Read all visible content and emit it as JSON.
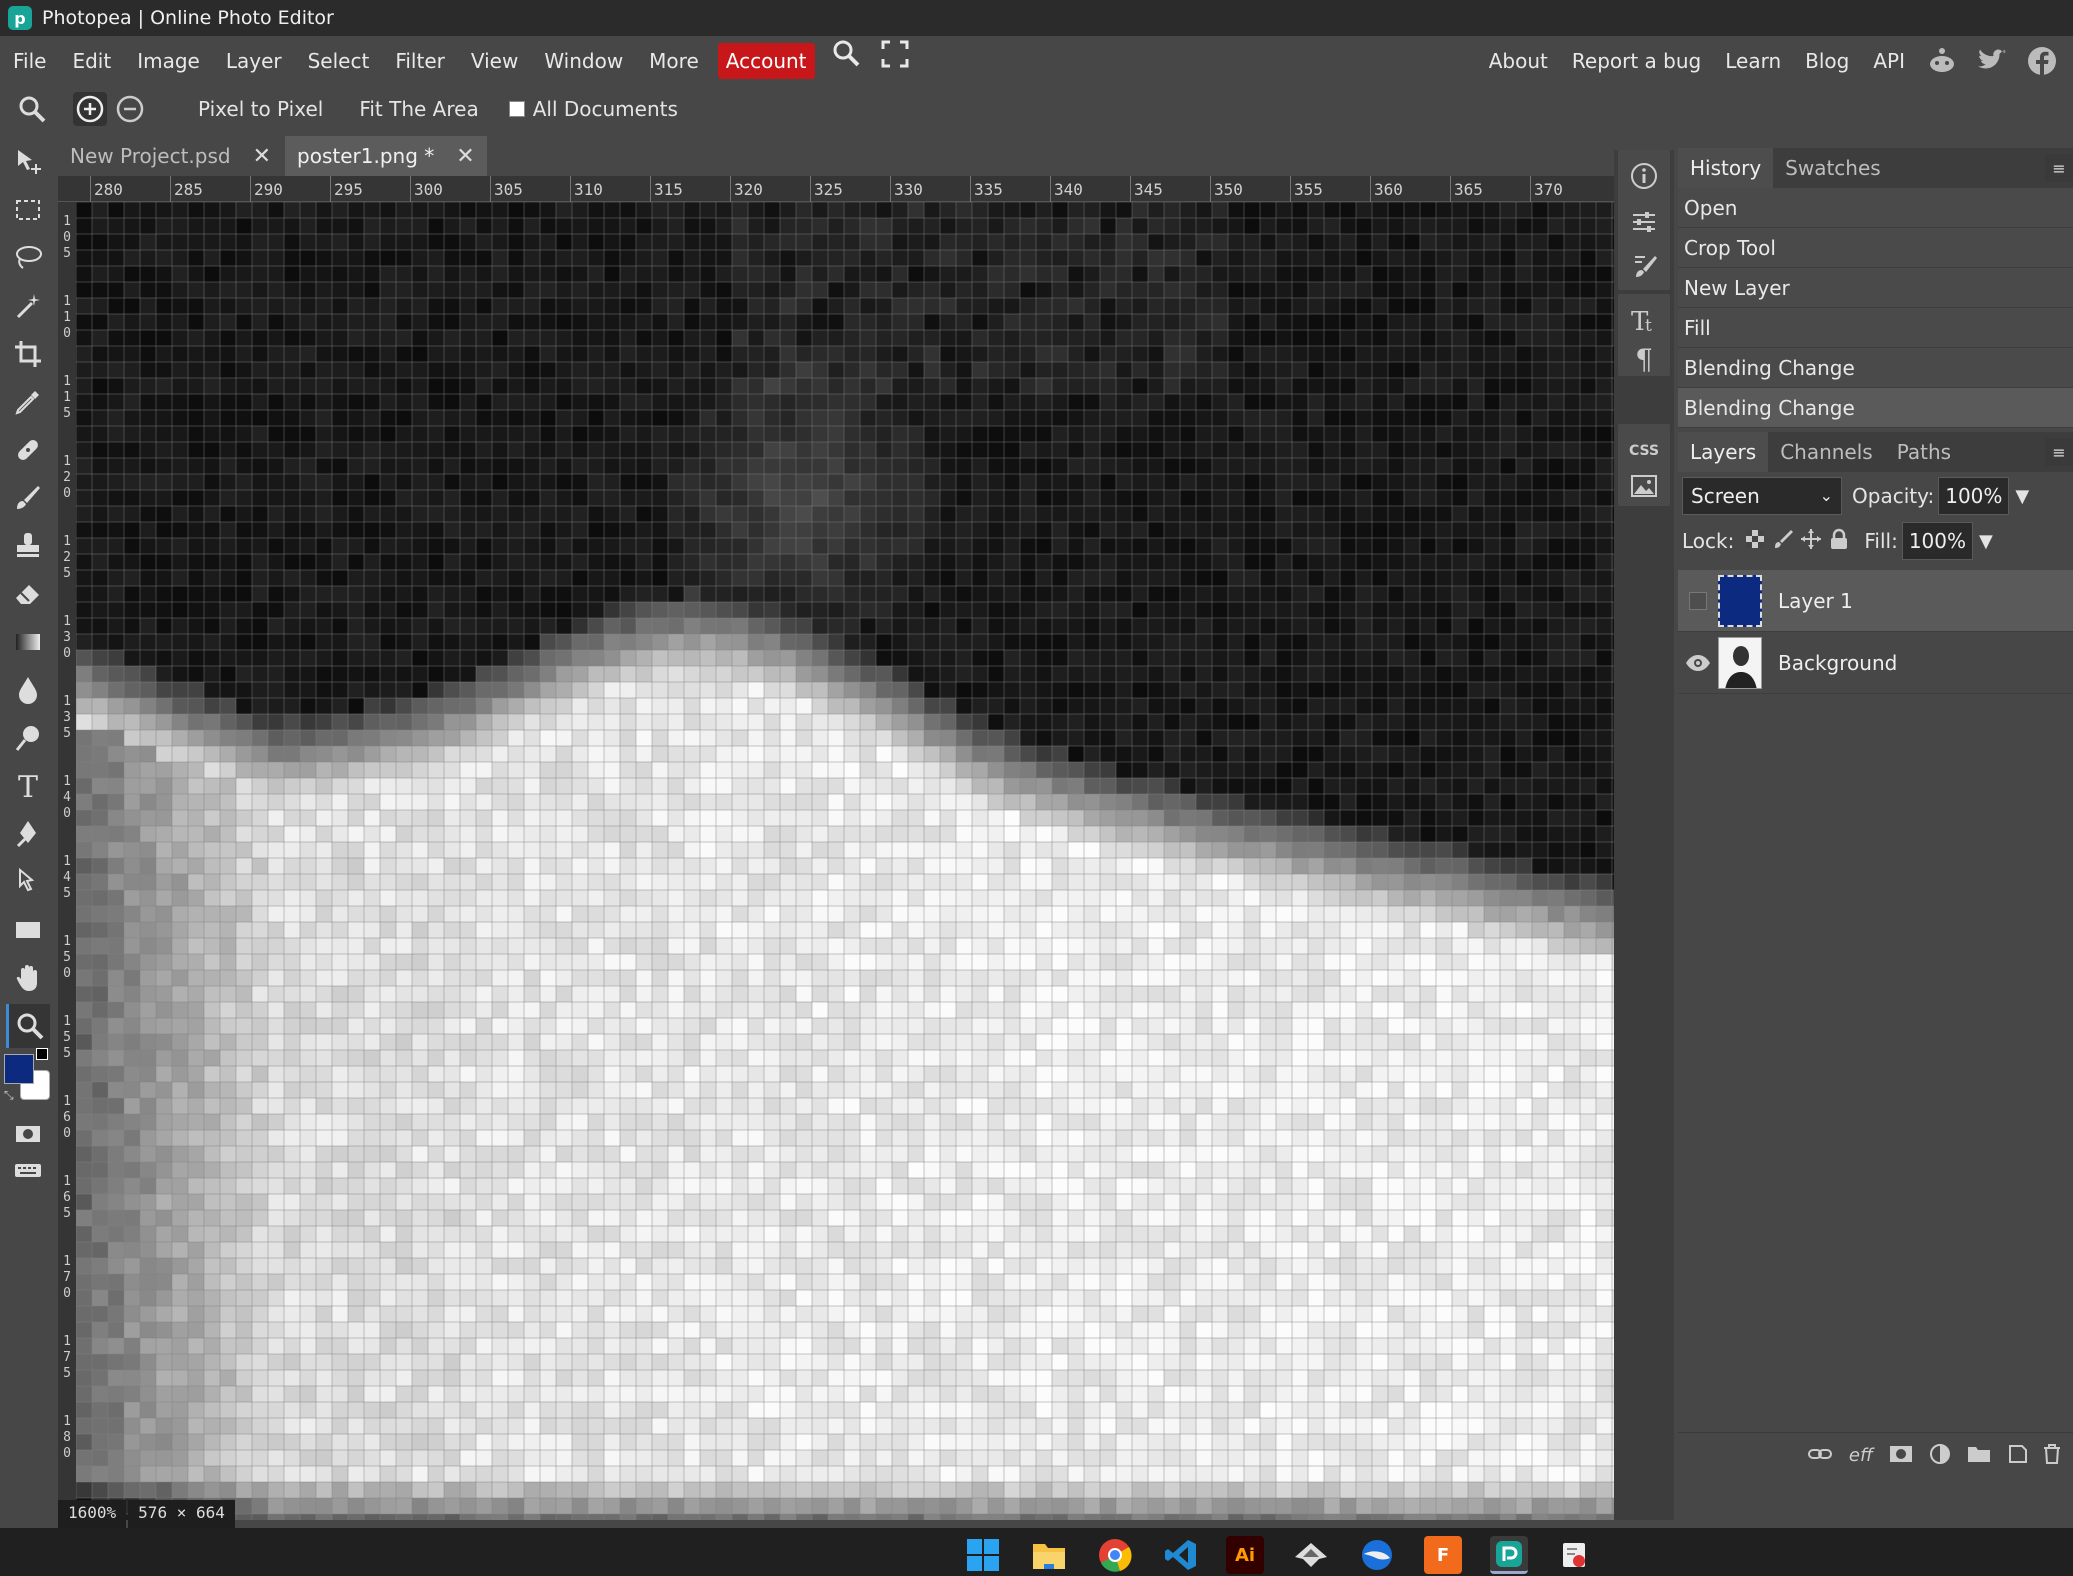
{
  "window": {
    "title": "Photopea | Online Photo Editor"
  },
  "menu": {
    "items": [
      "File",
      "Edit",
      "Image",
      "Layer",
      "Select",
      "Filter",
      "View",
      "Window",
      "More"
    ],
    "account": "Account",
    "right": [
      "About",
      "Report a bug",
      "Learn",
      "Blog",
      "API"
    ]
  },
  "options": {
    "pixel_to_pixel": "Pixel to Pixel",
    "fit_the_area": "Fit The Area",
    "all_documents": "All Documents"
  },
  "doc_tabs": [
    {
      "label": "New Project.psd",
      "close": "✕"
    },
    {
      "label": "poster1.png *",
      "close": "✕"
    }
  ],
  "ruler": {
    "h_ticks": [
      "280",
      "285",
      "290",
      "295",
      "300",
      "305",
      "310",
      "315",
      "320",
      "325",
      "330",
      "335",
      "340",
      "345",
      "350",
      "355",
      "360",
      "365",
      "370"
    ],
    "v_ticks": [
      "105",
      "110",
      "115",
      "120",
      "125",
      "130",
      "135",
      "140",
      "145",
      "150",
      "155",
      "160",
      "165",
      "170",
      "175",
      "180"
    ]
  },
  "status": {
    "zoom": "1600%",
    "size": "576 × 664"
  },
  "history_panel": {
    "tabs": [
      "History",
      "Swatches"
    ],
    "items": [
      "Open",
      "Crop Tool",
      "New Layer",
      "Fill",
      "Blending Change",
      "Blending Change"
    ]
  },
  "layers_panel": {
    "tabs": [
      "Layers",
      "Channels",
      "Paths"
    ],
    "blend_mode": "Screen",
    "opacity_label": "Opacity:",
    "opacity": "100%",
    "lock_label": "Lock:",
    "fill_label": "Fill:",
    "fill": "100%",
    "layers": [
      {
        "name": "Layer 1",
        "visible": false,
        "selected": true
      },
      {
        "name": "Background",
        "visible": true,
        "selected": false
      }
    ],
    "footer_icons": [
      "link-icon",
      "effects-icon",
      "mask-icon",
      "adjustment-icon",
      "folder-icon",
      "new-layer-icon",
      "trash-icon"
    ]
  },
  "colors": {
    "foreground": "#0b2a80",
    "background": "#ffffff",
    "account": "#c8171b",
    "accent": "#3d8bd6",
    "app_icon": "#18a497"
  },
  "side_panel_icons": [
    "info-icon",
    "adjustments-icon",
    "brush-settings-icon",
    "character-icon",
    "paragraph-icon",
    "css-icon",
    "image-icon"
  ]
}
